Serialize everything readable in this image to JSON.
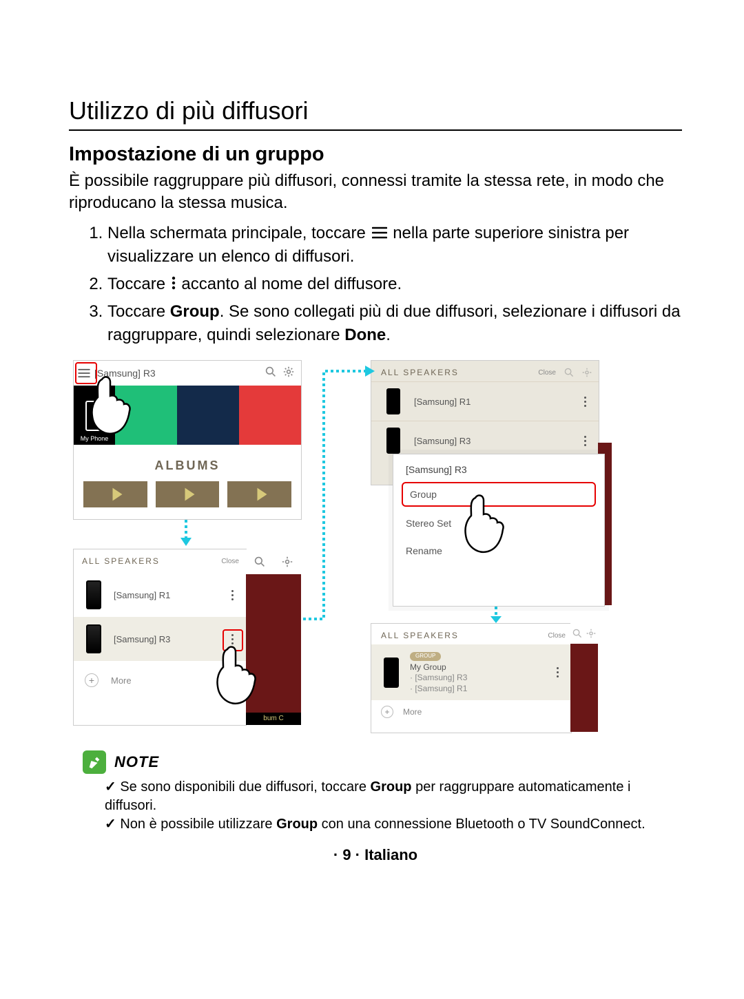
{
  "h1": "Utilizzo di più diffusori",
  "h2": "Impostazione di un gruppo",
  "intro": "È possibile raggruppare più diffusori, connessi tramite la stessa rete, in modo che riproducano la stessa musica.",
  "steps": {
    "s1a": "Nella schermata principale, toccare ",
    "s1b": " nella parte superiore sinistra per visualizzare un elenco di diffusori.",
    "s2a": "Toccare ",
    "s2b": " accanto al nome del diffusore.",
    "s3a": "Toccare ",
    "s3bold1": "Group",
    "s3b": ". Se sono collegati più di due diffusori, selezionare i diffusori da raggruppare, quindi selezionare ",
    "s3bold2": "Done",
    "s3c": "."
  },
  "shots": {
    "s1": {
      "title": "[Samsung] R3",
      "myphone": "My Phone",
      "albums": "ALBUMS"
    },
    "s2": {
      "all": "ALL SPEAKERS",
      "close": "Close",
      "r1": "[Samsung] R1",
      "r3": "[Samsung] R3",
      "more": "More",
      "bumc": "bum C"
    },
    "s3": {
      "all": "ALL SPEAKERS",
      "close": "Close",
      "r1": "[Samsung] R1",
      "r3": "[Samsung] R3"
    },
    "popup": {
      "title": "[Samsung] R3",
      "group": "Group",
      "stereo": "Stereo Set",
      "rename": "Rename"
    },
    "s4": {
      "all": "ALL SPEAKERS",
      "close": "Close",
      "badge": "GROUP",
      "name": "My Group",
      "sub1": "· [Samsung] R3",
      "sub2": "· [Samsung] R1",
      "more": "More"
    }
  },
  "note": {
    "label": "NOTE",
    "n1a": "Se sono disponibili due diffusori, toccare ",
    "n1b": "Group",
    "n1c": " per raggruppare automaticamente i diffusori.",
    "n2a": "Non è possibile utilizzare ",
    "n2b": "Group",
    "n2c": " con una connessione Bluetooth o TV SoundConnect."
  },
  "footer": "· 9 · Italiano"
}
